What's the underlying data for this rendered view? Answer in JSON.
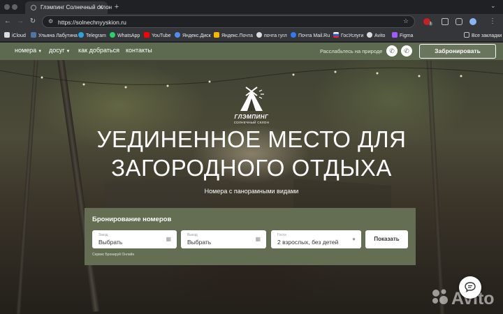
{
  "browser": {
    "tab_title": "Глэмпинг Солнечный склон",
    "url": "https://solnechnyyskion.ru",
    "bookmarks": [
      "iCloud",
      "Ульяна Лабутина",
      "Telegram",
      "WhatsApp",
      "YouTube",
      "Яндекс.Диск",
      "Яндекс.Почта",
      "почта гугл",
      "Почта Mail.Ru",
      "ГосУслуги",
      "Avito",
      "Figma"
    ],
    "all_bookmarks": "Все закладки",
    "ext_badge": "1"
  },
  "site": {
    "nav": {
      "rooms": "номера",
      "leisure": "досуг",
      "directions": "как добраться",
      "contacts": "контакты",
      "tagline": "Расслабьтесь на природе",
      "book": "Забронировать"
    },
    "logo": {
      "name": "ГЛЭМПИНГ",
      "sub": "СОЛНЕЧНЫЙ СКЛОН"
    },
    "hero": {
      "title_line1": "УЕДИНЕННОЕ МЕСТО ДЛЯ",
      "title_line2": "ЗАГОРОДНОГО ОТДЫХА",
      "subtitle": "Номера с панорамными видами"
    },
    "booking": {
      "title": "Бронирование номеров",
      "checkin_label": "Заезд",
      "checkin_value": "Выбрать",
      "checkout_label": "Выезд",
      "checkout_value": "Выбрать",
      "guests_label": "Гости",
      "guests_value": "2 взрослых, без детей",
      "show": "Показать",
      "service": "Сервис Бронируй Онлайн"
    },
    "watermark": "Avito"
  },
  "colors": {
    "nav_green": "#5d6a4f",
    "booking_green": "#646e53"
  }
}
